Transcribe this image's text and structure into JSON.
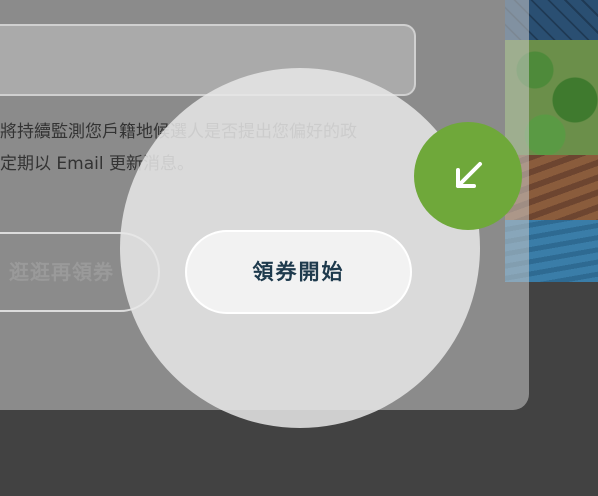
{
  "description": {
    "line1": "將持續監測您戶籍地候選人是否提出您偏好的政",
    "line2": "定期以 Email 更新消息。"
  },
  "buttons": {
    "secondary_label": "逛逛再領券",
    "primary_label": "領券開始"
  },
  "fab": {
    "icon": "arrow-down-left-icon",
    "color": "#6fa83a"
  },
  "colors": {
    "primary_text": "#1e3a4d",
    "overlay_bg": "#424242"
  }
}
